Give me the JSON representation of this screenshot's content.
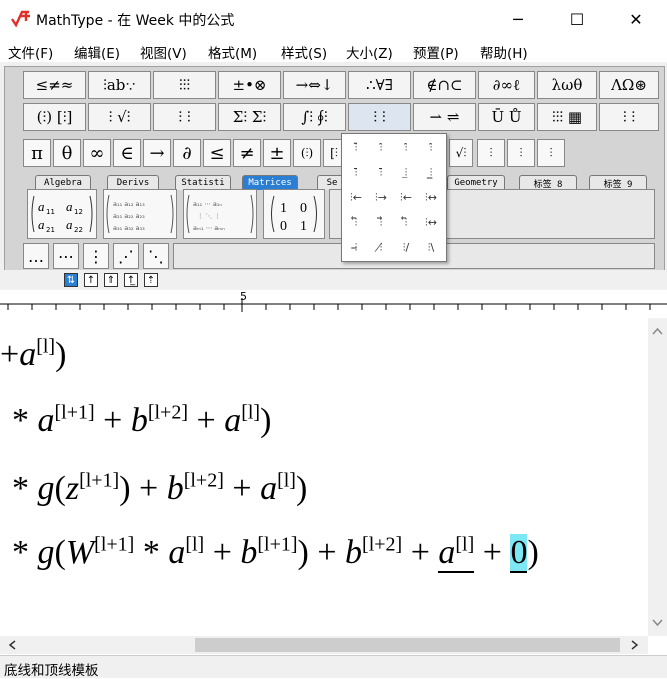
{
  "window": {
    "title": "MathType - 在 Week 中的公式",
    "minimize": "─",
    "maximize": "☐",
    "close": "✕"
  },
  "menu": [
    "文件(F)",
    "编辑(E)",
    "视图(V)",
    "格式(M)",
    "样式(S)",
    "大小(Z)",
    "预置(P)",
    "帮助(H)"
  ],
  "palette_row1": [
    "≤≠≈",
    "⫶ab∵",
    "⫶⫶⫶",
    "±•⊗",
    "→⇔↓",
    "∴∀∃",
    "∉∩⊂",
    "∂∞ℓ",
    "λωθ",
    "ΛΩ⊛"
  ],
  "palette_row2": [
    "(⫶) [⫶]",
    "⫶ √⫶",
    "⫶ ⫶",
    "Σ⫶ Σ⫶",
    "∫⫶ ∮⫶",
    "⫶ ⫶",
    "⇀ ⇌",
    "Ū Ů",
    "⫶⫶⫶ ▦",
    "⫶ ⫶"
  ],
  "symbol_row": [
    "π",
    "θ",
    "∞",
    "∈",
    "→",
    "∂",
    "≤",
    "≠",
    "±",
    "(⫶)",
    "[⫶"
  ],
  "symbol_row_right": [
    "√⫶",
    "⫶",
    "⫶",
    "⫶"
  ],
  "tabs": [
    "Algebra",
    "Derivs",
    "Statisti",
    "Matrices",
    "Se",
    "Geometry",
    "标签 8",
    "标签 9"
  ],
  "active_tab": "Matrices",
  "templates": [
    {
      "a": "a",
      "r1": [
        "a11",
        "a12"
      ],
      "r2": [
        "a21",
        "a22"
      ]
    },
    {
      "r1": [
        "1",
        "0"
      ],
      "r2": [
        "0",
        "1"
      ]
    }
  ],
  "dots_row": [
    "…",
    "⋯",
    "⋮",
    "⋰",
    "⋱"
  ],
  "dropdown_cells": [
    "⫶̃",
    "⫶̂",
    "⫶̂",
    "⫶̂",
    "⫶̄",
    "⫶̄",
    "⫶̲",
    "⫶̳",
    "⫶←",
    "⫶→",
    "⫶←",
    "⫶↔",
    "⫶⃖",
    "⫶⃗",
    "⫶⃖",
    "⫶↔",
    "⫶̶",
    "⫶̸",
    "⫶/",
    "⫶\\"
  ],
  "align_buttons": [
    "⇅",
    "↑",
    "⇑",
    "↑̲",
    "⇡"
  ],
  "ruler_mark": "5",
  "equations": [
    {
      "parts": [
        "+",
        "a",
        "[l]",
        ")"
      ]
    },
    {
      "parts": [
        "* ",
        "a",
        "[l+1]",
        " + ",
        "b",
        "[l+2]",
        " + ",
        "a",
        "[l]",
        ")"
      ]
    },
    {
      "parts": [
        "* ",
        "g",
        "(",
        "z",
        "[l+1]",
        ") + ",
        "b",
        "[l+2]",
        " + ",
        "a",
        "[l]",
        ")"
      ]
    },
    {
      "parts": [
        "* ",
        "g",
        "(",
        "W",
        "[l+1]",
        " * ",
        "a",
        "[l]",
        " + ",
        "b",
        "[l+1]",
        ") + ",
        "b",
        "[l+2]",
        " + ",
        "a",
        "[l]",
        " + ",
        "0",
        ")"
      ]
    }
  ],
  "status": "底线和顶线模板",
  "colors": {
    "accent": "#2a7fd4",
    "cursor": "#7de7f3",
    "logo": "#e0302a"
  }
}
